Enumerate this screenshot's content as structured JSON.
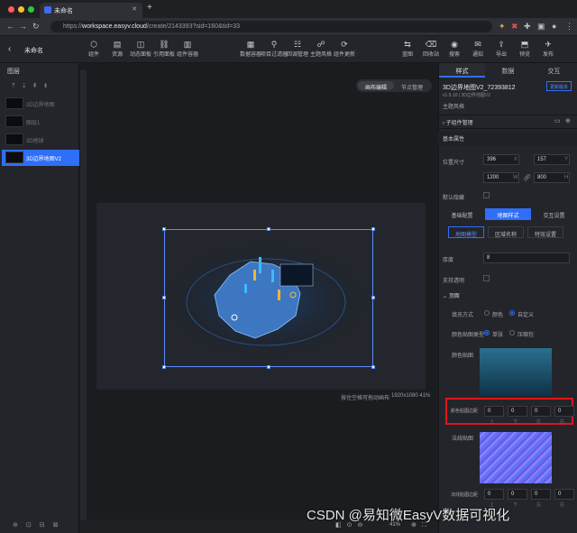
{
  "browser": {
    "tab_title": "未命名",
    "url_host": "workspace.easyv.cloud",
    "url_prefix": "https://",
    "url_path": "/create/2143393?sid=160&tid=33"
  },
  "app": {
    "title": "未命名",
    "toolbar_left": [
      "组件",
      "资源",
      "动态面板",
      "引用面板",
      "组件容器"
    ],
    "toolbar_mid": [
      "数据容器",
      "项目过滤器",
      "回调管理",
      "主题风格",
      "组件更新"
    ],
    "toolbar_right": [
      "蓝图",
      "回收站",
      "搜索",
      "通知",
      "导出",
      "预览",
      "发布"
    ]
  },
  "layers": {
    "title": "图层",
    "items": [
      "3D边界地图",
      "图层1",
      "3D地球",
      "3D边界地图V2"
    ],
    "selected": "3D边界地图V2"
  },
  "canvas": {
    "seg_edit": "画布编辑",
    "seg_nodes": "节点管理",
    "hint": "按住空格可拖动画布",
    "resolution": "1920x1080 41%",
    "zoom": "41%"
  },
  "panel": {
    "tabs": [
      "样式",
      "数据",
      "交互"
    ],
    "component_name": "3D边界地图V2_72393812",
    "version": "v1.9.10 | 3D边界地图V2",
    "update_btn": "更新版本",
    "theme": "主题风格",
    "sub_manage": "子组件管理",
    "basic": "基本属性",
    "pos_label": "位置尺寸",
    "x": "396",
    "y": "157",
    "w": "1200",
    "h": "800",
    "x_u": "X",
    "y_u": "Y",
    "w_u": "W",
    "h_u": "H",
    "hide_label": "默认隐藏",
    "subtabs": [
      "基础配置",
      "地图样式",
      "交互设置"
    ],
    "inner_tabs": [
      "地图模型",
      "区域名称",
      "特效设置"
    ],
    "thickness_label": "厚度",
    "thickness": "8",
    "transparent_label": "支持透明",
    "top_section": "顶面",
    "fill_label": "填充方式",
    "fill_opt1": "颜色",
    "fill_opt2": "自定义",
    "tex_type_label": "颜色贴图类型",
    "tex_type1": "单张",
    "tex_type2": "压缩包",
    "color_tex_label": "颜色贴图",
    "margin_label": "颜色贴图边距",
    "margins": [
      "0",
      "0",
      "0",
      "0"
    ],
    "margin_units": [
      "上",
      "下",
      "左",
      "右"
    ],
    "normal_label": "法线贴图",
    "normal_margin_label": "法线贴图边距"
  },
  "watermark": "CSDN @易知微EasyV数据可视化"
}
